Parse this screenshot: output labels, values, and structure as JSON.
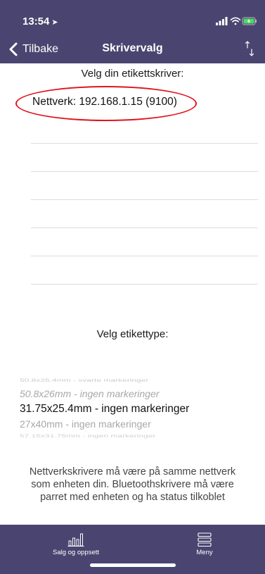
{
  "status_bar": {
    "time": "13:54",
    "location_icon": "location-arrow-icon",
    "signal_icon": "cellular-signal-icon",
    "wifi_icon": "wifi-icon",
    "battery_icon": "battery-charging-icon"
  },
  "nav": {
    "back_label": "Tilbake",
    "title": "Skrivervalg",
    "sort_icon": "sort-arrows-icon"
  },
  "printers": {
    "heading": "Velg din etikettskriver:",
    "items": [
      "Nettverk: 192.168.1.15 (9100)"
    ]
  },
  "label_types": {
    "heading": "Velg etikettype:",
    "options": [
      "50.8x25.4mm - svarte markeringer",
      "50.8x26mm - ingen markeringer",
      "31.75x25.4mm - ingen markeringer",
      "27x40mm - ingen markeringer",
      "57.15x31.75mm - ingen markeringer"
    ],
    "selected": "31.75x25.4mm - ingen markeringer"
  },
  "info_text": "Nettverkskrivere må være på samme nettverk som enheten din. Bluetoothskrivere må være parret med enheten og ha status tilkoblet",
  "tabbar": {
    "items": [
      {
        "label": "Salg og oppsett",
        "icon": "bar-chart-icon"
      },
      {
        "label": "Meny",
        "icon": "menu-icon"
      }
    ]
  },
  "colors": {
    "header_bg": "#4a4570",
    "highlight_ring": "#e0141e"
  }
}
